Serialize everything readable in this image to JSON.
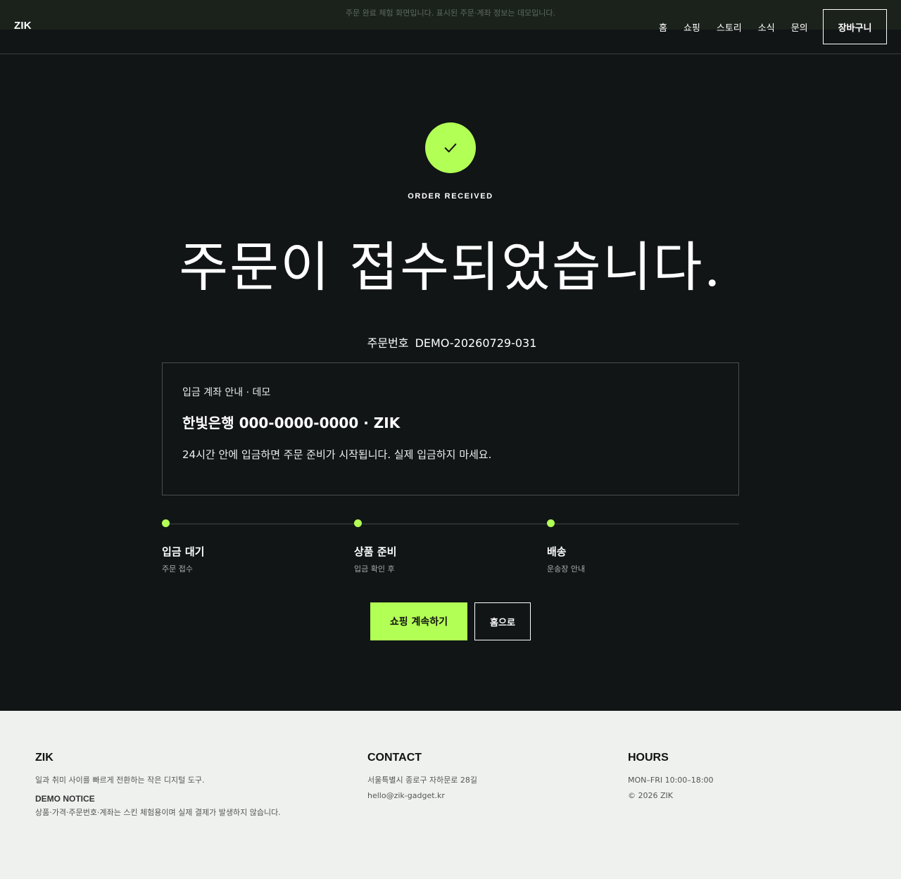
{
  "banner": {
    "text": "주문 완료 체험 화면입니다. 표시된 주문·계좌 정보는 데모입니다."
  },
  "header": {
    "logo": "ZIK",
    "nav": [
      "홈",
      "쇼핑",
      "스토리",
      "소식",
      "문의"
    ],
    "cart_label": "장바구니"
  },
  "hero": {
    "eyebrow": "ORDER RECEIVED",
    "title": "주문이 접수되었습니다.",
    "order_label": "주문번호",
    "order_number": "DEMO-20260729-031"
  },
  "deposit": {
    "label": "입금 계좌 안내 · 데모",
    "account": "한빛은행 000-0000-0000 · ZIK",
    "note": "24시간 안에 입금하면 주문 준비가 시작됩니다. 실제 입금하지 마세요."
  },
  "steps": [
    {
      "title": "입금 대기",
      "sub": "주문 접수"
    },
    {
      "title": "상품 준비",
      "sub": "입금 확인 후"
    },
    {
      "title": "배송",
      "sub": "운송장 안내"
    }
  ],
  "actions": {
    "continue_label": "쇼핑 계속하기",
    "home_label": "홈으로"
  },
  "footer": {
    "brand": {
      "title": "ZIK",
      "desc": "일과 취미 사이를 빠르게 전환하는 작은 디지털 도구.",
      "notice_title": "DEMO NOTICE",
      "notice_text": "상품·가격·주문번호·계좌는 스킨 체험용이며 실제 결제가 발생하지 않습니다."
    },
    "contact": {
      "title": "CONTACT",
      "address": "서울특별시 종로구 자하문로 28길",
      "email": "hello@zik-gadget.kr"
    },
    "hours": {
      "title": "HOURS",
      "hours": "MON–FRI 10:00–18:00",
      "copyright": "© 2026 ZIK"
    }
  },
  "colors": {
    "accent": "#b2ff55",
    "background": "#111516",
    "footer_bg": "#eff1ef"
  }
}
